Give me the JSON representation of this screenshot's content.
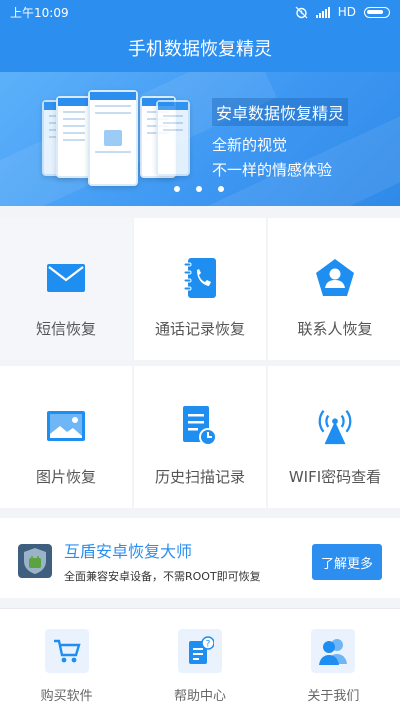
{
  "status_bar": {
    "time": "上午10:09",
    "network": "HD"
  },
  "title": "手机数据恢复精灵",
  "banner": {
    "title": "安卓数据恢复精灵",
    "line1": "全新的视觉",
    "line2": "不一样的情感体验",
    "page_count": 3
  },
  "features": [
    {
      "label": "短信恢复",
      "icon": "envelope-icon"
    },
    {
      "label": "通话记录恢复",
      "icon": "call-log-icon"
    },
    {
      "label": "联系人恢复",
      "icon": "contact-icon"
    },
    {
      "label": "图片恢复",
      "icon": "picture-icon"
    },
    {
      "label": "历史扫描记录",
      "icon": "history-document-icon"
    },
    {
      "label": "WIFI密码查看",
      "icon": "wifi-signal-icon"
    }
  ],
  "promo": {
    "title": "互盾安卓恢复大师",
    "subtitle": "全面兼容安卓设备，不需ROOT即可恢复",
    "button": "了解更多"
  },
  "bottom_nav": [
    {
      "label": "购买软件",
      "icon": "cart-icon"
    },
    {
      "label": "帮助中心",
      "icon": "help-document-icon"
    },
    {
      "label": "关于我们",
      "icon": "people-icon"
    }
  ],
  "colors": {
    "primary": "#2c8ff0",
    "icon_blue": "#1f8ef1"
  }
}
